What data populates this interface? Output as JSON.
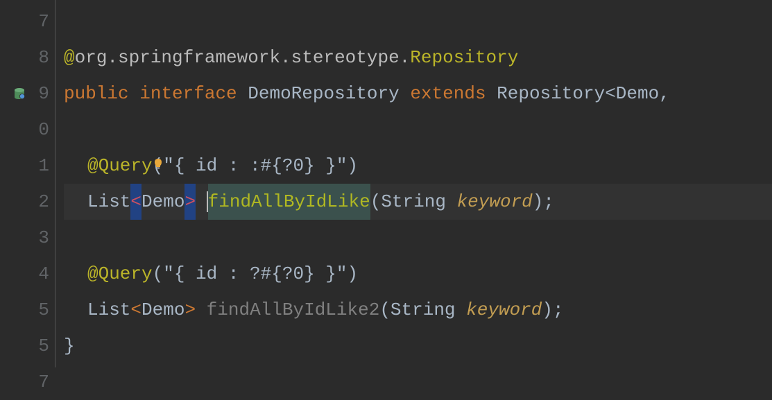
{
  "gutter": {
    "lines": [
      "7",
      "8",
      "9",
      "0",
      "1",
      "2",
      "3",
      "4",
      "5",
      "5",
      "7"
    ]
  },
  "code": {
    "l1": {
      "at": "@",
      "fqn": "org.springframework.stereotype.",
      "cls": "Repository"
    },
    "l2": {
      "kw1": "public",
      "sp1": " ",
      "kw2": "interface",
      "sp2": " ",
      "cls": "DemoRepository",
      "sp3": " ",
      "ext": "extends",
      "sp4": " ",
      "base": "Repository",
      "lt": "<",
      "param": "Demo",
      "comma": ","
    },
    "l4": {
      "ann": "@Query",
      "lp": "(",
      "str": "\"{ id : :#{?0} }\"",
      "rp": ")"
    },
    "l5": {
      "type": "List",
      "lt": "<",
      "param": "Demo",
      "gt": ">",
      "sp": " ",
      "method": "findAllByIdLike",
      "lp": "(",
      "ptype": "String",
      "sp2": " ",
      "pname": "keyword",
      "rp": ")",
      "semi": ";"
    },
    "l7": {
      "ann": "@Query",
      "lp": "(",
      "str": "\"{ id : ?#{?0} }\"",
      "rp": ")"
    },
    "l8": {
      "type": "List",
      "lt": "<",
      "param": "Demo",
      "gt": ">",
      "sp": " ",
      "method": "findAllByIdLike2",
      "lp": "(",
      "ptype": "String",
      "sp2": " ",
      "pname": "keyword",
      "rp": ")",
      "semi": ";"
    },
    "l9": {
      "brace": "}"
    }
  }
}
